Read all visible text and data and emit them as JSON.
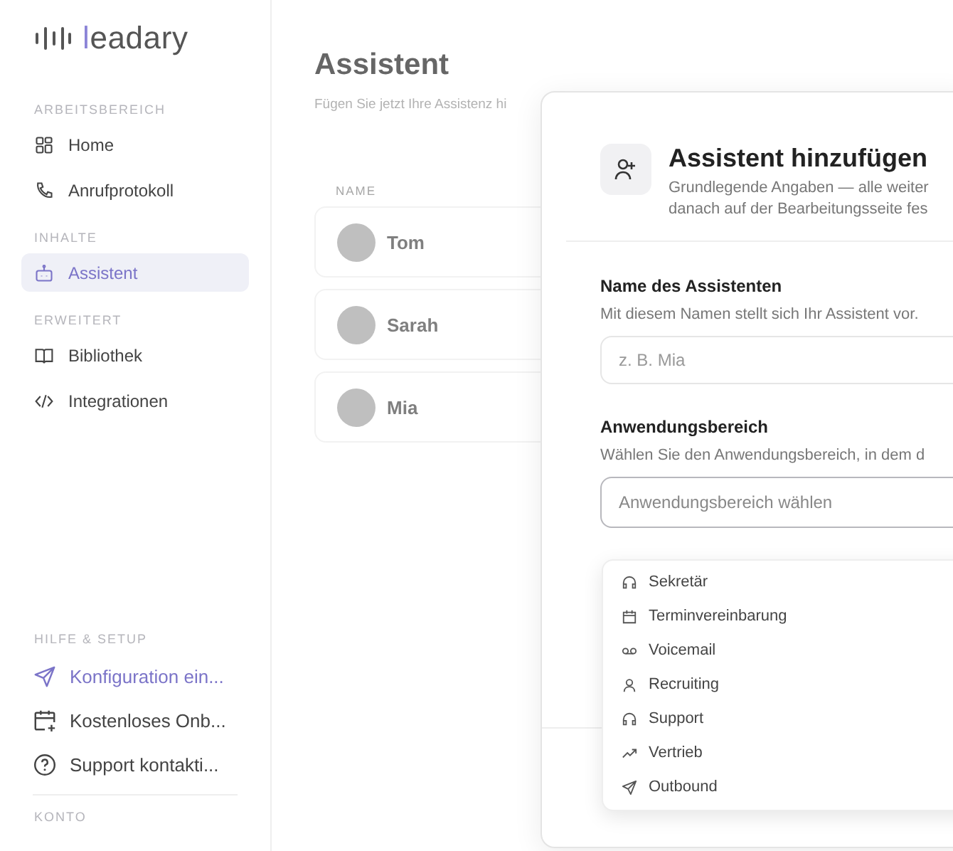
{
  "logo": {
    "text": "leadary"
  },
  "sidebar": {
    "sections": [
      {
        "title": "ARBEITSBEREICH",
        "items": [
          {
            "label": "Home",
            "selected": false
          },
          {
            "label": "Anrufprotokoll",
            "selected": false
          }
        ]
      },
      {
        "title": "INHALTE",
        "items": [
          {
            "label": "Assistent",
            "selected": true
          }
        ]
      },
      {
        "title": "ERWEITERT",
        "items": [
          {
            "label": "Bibliothek",
            "selected": false
          },
          {
            "label": "Integrationen",
            "selected": false
          }
        ]
      }
    ],
    "help": {
      "title": "HILFE & SETUP",
      "items": [
        {
          "label": "Konfiguration ein...",
          "kind": "accent"
        },
        {
          "label": "Kostenloses Onb...",
          "kind": "plain"
        },
        {
          "label": "Support kontakti...",
          "kind": "plain"
        }
      ]
    },
    "account": {
      "title": "KONTO"
    }
  },
  "page": {
    "title": "Assistent",
    "subtitle": "Fügen Sie jetzt Ihre Assistenz hi"
  },
  "table": {
    "columns": [
      "NAME"
    ],
    "rows": [
      {
        "name": "Tom"
      },
      {
        "name": "Sarah"
      },
      {
        "name": "Mia"
      }
    ]
  },
  "dialog": {
    "title": "Assistent hinzufügen",
    "subtitle_lines": [
      "Grundlegende Angaben — alle weiter",
      "danach auf der Bearbeitungsseite fes"
    ],
    "fields": [
      {
        "label": "Name des Assistenten",
        "help": "Mit diesem Namen stellt sich Ihr Assistent vor.",
        "placeholder": "z. B. Mia",
        "kind": "input"
      },
      {
        "label": "Anwendungsbereich",
        "help": "Wählen Sie den Anwendungsbereich, in dem d",
        "placeholder": "Anwendungsbereich wählen",
        "kind": "select"
      }
    ],
    "dropdown": [
      {
        "label": "Sekretär"
      },
      {
        "label": "Terminvereinbarung"
      },
      {
        "label": "Voicemail"
      },
      {
        "label": "Recruiting"
      },
      {
        "label": "Support"
      },
      {
        "label": "Vertrieb"
      },
      {
        "label": "Outbound"
      }
    ]
  }
}
